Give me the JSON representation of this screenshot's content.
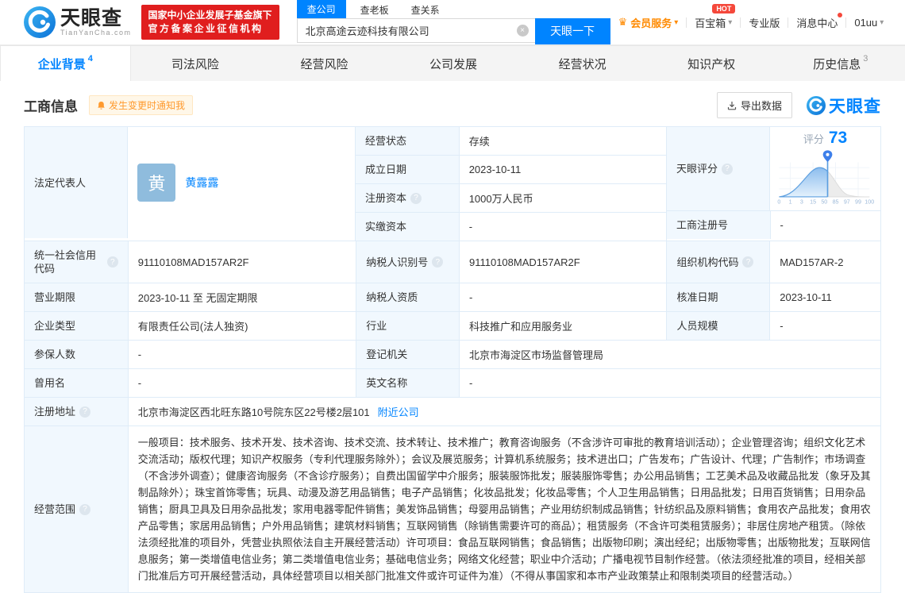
{
  "colors": {
    "accent": "#0084ff",
    "brand_red": "#e01e1e",
    "orange": "#ff9a2e",
    "avatar_blue": "#8fbcdd",
    "table_border": "#dfecf8",
    "label_bg": "#f1f8fe"
  },
  "icons": {
    "help": "?",
    "caret": "▾",
    "clear": "×",
    "crown": "♛"
  },
  "header": {
    "logo": {
      "title": "天眼查",
      "subtitle": "TianYanCha.com"
    },
    "badge": {
      "line1": "国家中小企业发展子基金旗下",
      "line2": "官方备案企业征信机构"
    },
    "search": {
      "tabs": [
        {
          "label": "查公司"
        },
        {
          "label": "查老板"
        },
        {
          "label": "查关系"
        }
      ],
      "value": "北京高途云迹科技有限公司",
      "button": "天眼一下"
    },
    "menu": {
      "vip": "会员服务",
      "toolbox": "百宝箱",
      "hot": "HOT",
      "pro": "专业版",
      "messages": "消息中心",
      "user": "01uu"
    }
  },
  "nav": {
    "tabs": [
      {
        "label": "企业背景",
        "count": "4"
      },
      {
        "label": "司法风险"
      },
      {
        "label": "经营风险"
      },
      {
        "label": "公司发展"
      },
      {
        "label": "经营状况"
      },
      {
        "label": "知识产权"
      },
      {
        "label": "历史信息",
        "count": "3"
      }
    ]
  },
  "section": {
    "title": "工商信息",
    "notify": "发生变更时通知我",
    "export": "导出数据",
    "watermark": "天眼查"
  },
  "score": {
    "label": "天眼评分",
    "caption": "评分",
    "value": "73",
    "axis": [
      "0",
      "1",
      "3",
      "15",
      "50",
      "85",
      "97",
      "99",
      "100"
    ]
  },
  "fields": {
    "legal_rep": {
      "label": "法定代表人",
      "avatar": "黄",
      "name": "黄露露"
    },
    "status": {
      "label": "经营状态",
      "value": "存续"
    },
    "established": {
      "label": "成立日期",
      "value": "2023-10-11"
    },
    "reg_capital": {
      "label": "注册资本",
      "value": "1000万人民币"
    },
    "paid_capital": {
      "label": "实缴资本",
      "value": "-"
    },
    "reg_number": {
      "label": "工商注册号",
      "value": "-"
    },
    "credit_code": {
      "label": "统一社会信用代码",
      "value": "91110108MAD157AR2F"
    },
    "taxpayer_id": {
      "label": "纳税人识别号",
      "value": "91110108MAD157AR2F"
    },
    "org_code": {
      "label": "组织机构代码",
      "value": "MAD157AR-2"
    },
    "business_term": {
      "label": "营业期限",
      "value": "2023-10-11 至 无固定期限"
    },
    "taxpayer_quality": {
      "label": "纳税人资质",
      "value": "-"
    },
    "approval_date": {
      "label": "核准日期",
      "value": "2023-10-11"
    },
    "company_type": {
      "label": "企业类型",
      "value": "有限责任公司(法人独资)"
    },
    "industry": {
      "label": "行业",
      "value": "科技推广和应用服务业"
    },
    "staff_size": {
      "label": "人员规模",
      "value": "-"
    },
    "insured_count": {
      "label": "参保人数",
      "value": "-"
    },
    "registry": {
      "label": "登记机关",
      "value": "北京市海淀区市场监督管理局"
    },
    "former_name": {
      "label": "曾用名",
      "value": "-"
    },
    "english_name": {
      "label": "英文名称",
      "value": "-"
    },
    "address": {
      "label": "注册地址",
      "value": "北京市海淀区西北旺东路10号院东区22号楼2层101",
      "link": "附近公司"
    },
    "scope": {
      "label": "经营范围",
      "value": "一般项目：技术服务、技术开发、技术咨询、技术交流、技术转让、技术推广；教育咨询服务（不含涉许可审批的教育培训活动）；企业管理咨询；组织文化艺术交流活动；版权代理；知识产权服务（专利代理服务除外）；会议及展览服务；计算机系统服务；技术进出口；广告发布；广告设计、代理；广告制作；市场调查（不含涉外调查）；健康咨询服务（不含诊疗服务）；自费出国留学中介服务；服装服饰批发；服装服饰零售；办公用品销售；工艺美术品及收藏品批发（象牙及其制品除外）；珠宝首饰零售；玩具、动漫及游艺用品销售；电子产品销售；化妆品批发；化妆品零售；个人卫生用品销售；日用品批发；日用百货销售；日用杂品销售；厨具卫具及日用杂品批发；家用电器零配件销售；美发饰品销售；母婴用品销售；产业用纺织制成品销售；针纺织品及原料销售；食用农产品批发；食用农产品零售；家居用品销售；户外用品销售；建筑材料销售；互联网销售（除销售需要许可的商品）；租赁服务（不含许可类租赁服务）；非居住房地产租赁。（除依法须经批准的项目外，凭营业执照依法自主开展经营活动）许可项目：食品互联网销售；食品销售；出版物印刷；演出经纪；出版物零售；出版物批发；互联网信息服务；第一类增值电信业务；第二类增值电信业务；基础电信业务；网络文化经营；职业中介活动；广播电视节目制作经营。（依法须经批准的项目，经相关部门批准后方可开展经营活动，具体经营项目以相关部门批准文件或许可证件为准）（不得从事国家和本市产业政策禁止和限制类项目的经营活动。）"
    }
  }
}
